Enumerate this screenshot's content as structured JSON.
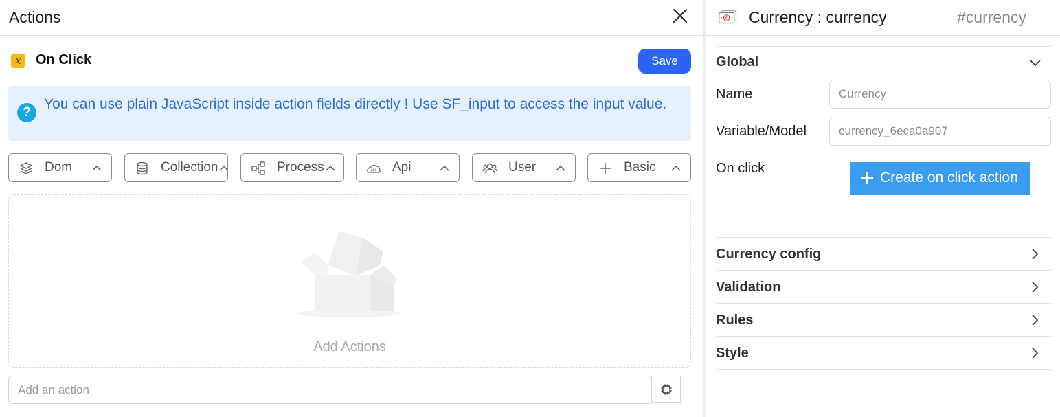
{
  "actions_panel": {
    "title": "Actions",
    "event": {
      "icon": "function-x-icon",
      "label": "On Click"
    },
    "save_label": "Save",
    "info_text": "You can use plain JavaScript inside action fields directly ! Use SF_input to access the input value.",
    "categories": [
      {
        "label": "Dom",
        "icon": "layers-icon"
      },
      {
        "label": "Collection",
        "icon": "database-icon"
      },
      {
        "label": "Process",
        "icon": "flow-icon"
      },
      {
        "label": "Api",
        "icon": "cloud-api-icon"
      },
      {
        "label": "User",
        "icon": "users-icon"
      },
      {
        "label": "Basic",
        "icon": "plus-icon"
      }
    ],
    "empty_label": "Add Actions",
    "add_action_placeholder": "Add an action"
  },
  "properties_panel": {
    "component_title": "Currency : currency",
    "component_id": "#currency",
    "global": {
      "title": "Global",
      "name_label": "Name",
      "name_placeholder": "Currency",
      "variable_label": "Variable/Model",
      "variable_placeholder": "currency_6eca0a907",
      "onclick_label": "On click",
      "create_action_label": "Create on click action"
    },
    "sections": [
      {
        "label": "Currency config"
      },
      {
        "label": "Validation"
      },
      {
        "label": "Rules"
      },
      {
        "label": "Style"
      }
    ]
  }
}
